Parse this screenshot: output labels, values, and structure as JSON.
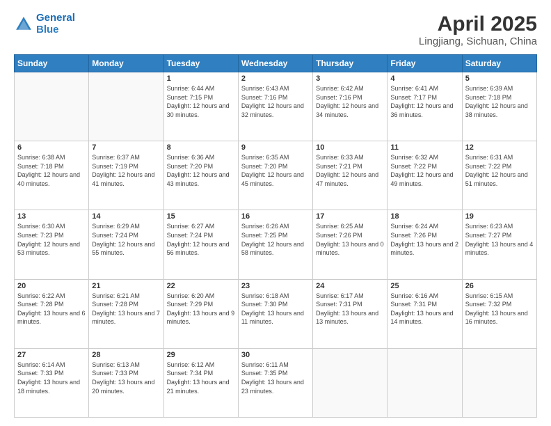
{
  "header": {
    "logo_line1": "General",
    "logo_line2": "Blue",
    "title": "April 2025",
    "subtitle": "Lingjiang, Sichuan, China"
  },
  "weekdays": [
    "Sunday",
    "Monday",
    "Tuesday",
    "Wednesday",
    "Thursday",
    "Friday",
    "Saturday"
  ],
  "weeks": [
    [
      {
        "day": "",
        "info": ""
      },
      {
        "day": "",
        "info": ""
      },
      {
        "day": "1",
        "info": "Sunrise: 6:44 AM\nSunset: 7:15 PM\nDaylight: 12 hours and 30 minutes."
      },
      {
        "day": "2",
        "info": "Sunrise: 6:43 AM\nSunset: 7:16 PM\nDaylight: 12 hours and 32 minutes."
      },
      {
        "day": "3",
        "info": "Sunrise: 6:42 AM\nSunset: 7:16 PM\nDaylight: 12 hours and 34 minutes."
      },
      {
        "day": "4",
        "info": "Sunrise: 6:41 AM\nSunset: 7:17 PM\nDaylight: 12 hours and 36 minutes."
      },
      {
        "day": "5",
        "info": "Sunrise: 6:39 AM\nSunset: 7:18 PM\nDaylight: 12 hours and 38 minutes."
      }
    ],
    [
      {
        "day": "6",
        "info": "Sunrise: 6:38 AM\nSunset: 7:18 PM\nDaylight: 12 hours and 40 minutes."
      },
      {
        "day": "7",
        "info": "Sunrise: 6:37 AM\nSunset: 7:19 PM\nDaylight: 12 hours and 41 minutes."
      },
      {
        "day": "8",
        "info": "Sunrise: 6:36 AM\nSunset: 7:20 PM\nDaylight: 12 hours and 43 minutes."
      },
      {
        "day": "9",
        "info": "Sunrise: 6:35 AM\nSunset: 7:20 PM\nDaylight: 12 hours and 45 minutes."
      },
      {
        "day": "10",
        "info": "Sunrise: 6:33 AM\nSunset: 7:21 PM\nDaylight: 12 hours and 47 minutes."
      },
      {
        "day": "11",
        "info": "Sunrise: 6:32 AM\nSunset: 7:22 PM\nDaylight: 12 hours and 49 minutes."
      },
      {
        "day": "12",
        "info": "Sunrise: 6:31 AM\nSunset: 7:22 PM\nDaylight: 12 hours and 51 minutes."
      }
    ],
    [
      {
        "day": "13",
        "info": "Sunrise: 6:30 AM\nSunset: 7:23 PM\nDaylight: 12 hours and 53 minutes."
      },
      {
        "day": "14",
        "info": "Sunrise: 6:29 AM\nSunset: 7:24 PM\nDaylight: 12 hours and 55 minutes."
      },
      {
        "day": "15",
        "info": "Sunrise: 6:27 AM\nSunset: 7:24 PM\nDaylight: 12 hours and 56 minutes."
      },
      {
        "day": "16",
        "info": "Sunrise: 6:26 AM\nSunset: 7:25 PM\nDaylight: 12 hours and 58 minutes."
      },
      {
        "day": "17",
        "info": "Sunrise: 6:25 AM\nSunset: 7:26 PM\nDaylight: 13 hours and 0 minutes."
      },
      {
        "day": "18",
        "info": "Sunrise: 6:24 AM\nSunset: 7:26 PM\nDaylight: 13 hours and 2 minutes."
      },
      {
        "day": "19",
        "info": "Sunrise: 6:23 AM\nSunset: 7:27 PM\nDaylight: 13 hours and 4 minutes."
      }
    ],
    [
      {
        "day": "20",
        "info": "Sunrise: 6:22 AM\nSunset: 7:28 PM\nDaylight: 13 hours and 6 minutes."
      },
      {
        "day": "21",
        "info": "Sunrise: 6:21 AM\nSunset: 7:28 PM\nDaylight: 13 hours and 7 minutes."
      },
      {
        "day": "22",
        "info": "Sunrise: 6:20 AM\nSunset: 7:29 PM\nDaylight: 13 hours and 9 minutes."
      },
      {
        "day": "23",
        "info": "Sunrise: 6:18 AM\nSunset: 7:30 PM\nDaylight: 13 hours and 11 minutes."
      },
      {
        "day": "24",
        "info": "Sunrise: 6:17 AM\nSunset: 7:31 PM\nDaylight: 13 hours and 13 minutes."
      },
      {
        "day": "25",
        "info": "Sunrise: 6:16 AM\nSunset: 7:31 PM\nDaylight: 13 hours and 14 minutes."
      },
      {
        "day": "26",
        "info": "Sunrise: 6:15 AM\nSunset: 7:32 PM\nDaylight: 13 hours and 16 minutes."
      }
    ],
    [
      {
        "day": "27",
        "info": "Sunrise: 6:14 AM\nSunset: 7:33 PM\nDaylight: 13 hours and 18 minutes."
      },
      {
        "day": "28",
        "info": "Sunrise: 6:13 AM\nSunset: 7:33 PM\nDaylight: 13 hours and 20 minutes."
      },
      {
        "day": "29",
        "info": "Sunrise: 6:12 AM\nSunset: 7:34 PM\nDaylight: 13 hours and 21 minutes."
      },
      {
        "day": "30",
        "info": "Sunrise: 6:11 AM\nSunset: 7:35 PM\nDaylight: 13 hours and 23 minutes."
      },
      {
        "day": "",
        "info": ""
      },
      {
        "day": "",
        "info": ""
      },
      {
        "day": "",
        "info": ""
      }
    ]
  ]
}
